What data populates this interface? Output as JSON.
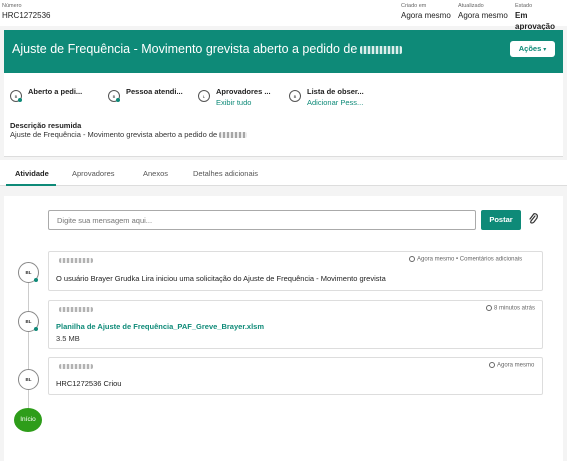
{
  "record": {
    "number_label": "Número",
    "number_value": "HRC1272536",
    "created_label": "Criado em",
    "created_value": "Agora mesmo",
    "updated_label": "Atualizado",
    "updated_value": "Agora mesmo",
    "state_label": "Estado",
    "state_value": "Em aprovação"
  },
  "header": {
    "title": "Ajuste de Frequência - Movimento grevista aberto a pedido de",
    "actions_label": "Ações",
    "accent_color": "#0e8a78"
  },
  "info": {
    "fields": [
      {
        "title": "Aberto a pedi...",
        "sub": "",
        "icon": "user-avatar-icon"
      },
      {
        "title": "Pessoa atendi...",
        "sub": "",
        "icon": "user-avatar-icon"
      },
      {
        "title": "Aprovadores ...",
        "sub": "Exibir tudo",
        "icon": "user-avatar-icon"
      },
      {
        "title": "Lista de obser...",
        "sub": "Adicionar Pess...",
        "icon": "user-avatar-icon"
      }
    ],
    "summary_label": "Descrição resumida",
    "summary_value": "Ajuste de Frequência - Movimento grevista aberto a pedido de"
  },
  "tabs": [
    "Atividade",
    "Aprovadores",
    "Anexos",
    "Detalhes adicionais"
  ],
  "activity": {
    "placeholder": "Digite sua mensagem aqui...",
    "post_label": "Postar",
    "entries": [
      {
        "avatar": "BL",
        "time": "Agora mesmo",
        "tag": "Comentários adicionais",
        "text": "O usuário Brayer Grudka Lira iniciou uma solicitação do Ajuste de Frequência - Movimento grevista"
      },
      {
        "avatar": "BL",
        "time": "8 minutos atrás",
        "file": "Planilha de Ajuste de Frequência_PAF_Greve_Brayer.xlsm",
        "size": "3.5 MB"
      },
      {
        "avatar": "BL",
        "time": "Agora mesmo",
        "text": "HRC1272536 Criou"
      }
    ],
    "start_label": "Início",
    "start_color": "#2e9d1a"
  }
}
